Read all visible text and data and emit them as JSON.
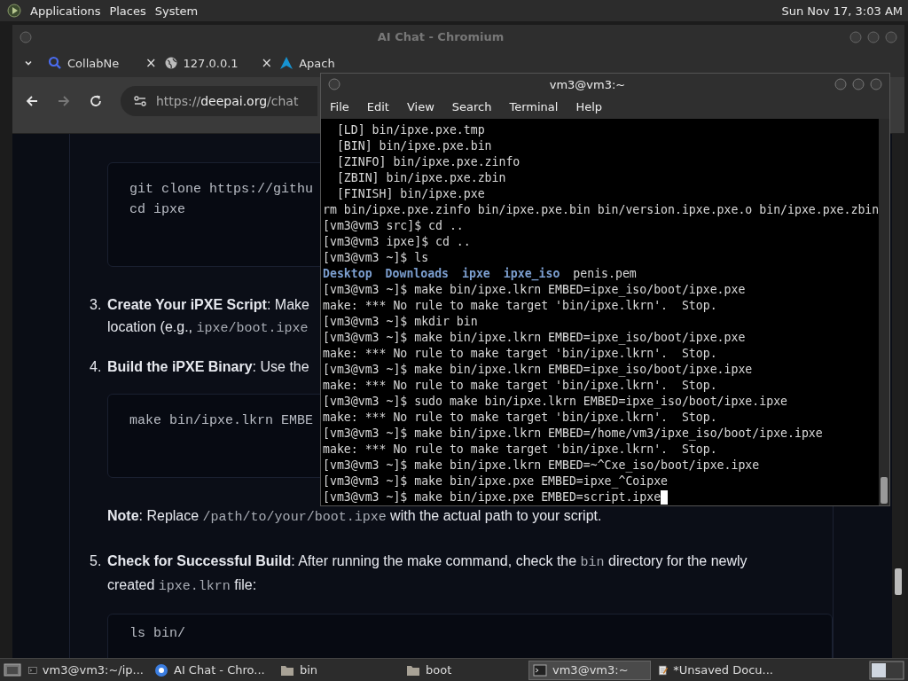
{
  "top_panel": {
    "menus": [
      "Applications",
      "Places",
      "System"
    ],
    "clock": "Sun Nov 17, 3:03 AM"
  },
  "browser": {
    "title": "AI Chat - Chromium",
    "tabs": [
      {
        "label": "CollabNe",
        "kind": "search",
        "close": "×",
        "selected": false
      },
      {
        "label": "127.0.0.1",
        "kind": "globe",
        "close": "×",
        "selected": false
      },
      {
        "label": "Apach",
        "kind": "peak",
        "selected": false
      }
    ],
    "address": {
      "scheme": "https://",
      "host": "deepai.org",
      "path": "/chat"
    },
    "forward_disabled": true,
    "content": [
      {
        "kind": "code",
        "lines": [
          "git clone https://githu",
          "cd ipxe"
        ]
      },
      {
        "kind": "step",
        "number": "3.",
        "lines": [
          [
            {
              "kind": "bold",
              "text": "Create Your iPXE Script"
            },
            {
              "kind": "text",
              "text": ": Make"
            }
          ],
          [
            {
              "kind": "text",
              "text": "location (e.g., "
            },
            {
              "kind": "code",
              "text": "ipxe/boot.ipxe"
            }
          ]
        ]
      },
      {
        "kind": "step",
        "number": "4.",
        "lines": [
          [
            {
              "kind": "bold",
              "text": "Build the iPXE Binary"
            },
            {
              "kind": "text",
              "text": ": Use the"
            }
          ]
        ]
      },
      {
        "kind": "code",
        "lines": [
          "make bin/ipxe.lkrn EMBE"
        ]
      },
      {
        "kind": "note",
        "lines": [
          [
            {
              "kind": "bold",
              "text": "Note"
            },
            {
              "kind": "text",
              "text": ": Replace "
            },
            {
              "kind": "code",
              "text": "/path/to/your/boot.ipxe"
            },
            {
              "kind": "text",
              "text": " with the actual path to your script."
            }
          ]
        ]
      },
      {
        "kind": "step",
        "number": "5.",
        "lines": [
          [
            {
              "kind": "bold",
              "text": "Check for Successful Build"
            },
            {
              "kind": "text",
              "text": ": After running the make command, check the "
            },
            {
              "kind": "code",
              "text": "bin"
            },
            {
              "kind": "text",
              "text": " directory for the newly"
            }
          ],
          [
            {
              "kind": "text",
              "text": "created "
            },
            {
              "kind": "code",
              "text": "ipxe.lkrn"
            },
            {
              "kind": "text",
              "text": " file:"
            }
          ]
        ]
      },
      {
        "kind": "code",
        "lines": [
          "ls bin/"
        ]
      }
    ]
  },
  "terminal": {
    "title": "vm3@vm3:~",
    "menus": [
      "File",
      "Edit",
      "View",
      "Search",
      "Terminal",
      "Help"
    ],
    "lines": [
      {
        "kind": "text",
        "text": "  [LD] bin/ipxe.pxe.tmp"
      },
      {
        "kind": "text",
        "text": "  [BIN] bin/ipxe.pxe.bin"
      },
      {
        "kind": "text",
        "text": "  [ZINFO] bin/ipxe.pxe.zinfo"
      },
      {
        "kind": "text",
        "text": "  [ZBIN] bin/ipxe.pxe.zbin"
      },
      {
        "kind": "text",
        "text": "  [FINISH] bin/ipxe.pxe"
      },
      {
        "kind": "text",
        "text": "rm bin/ipxe.pxe.zinfo bin/ipxe.pxe.bin bin/version.ipxe.pxe.o bin/ipxe.pxe.zbin"
      },
      {
        "kind": "text",
        "text": "[vm3@vm3 src]$ cd .."
      },
      {
        "kind": "text",
        "text": "[vm3@vm3 ipxe]$ cd .."
      },
      {
        "kind": "text",
        "text": "[vm3@vm3 ~]$ ls"
      },
      {
        "kind": "listing",
        "entries": [
          {
            "name": "Desktop",
            "kind": "dir"
          },
          {
            "name": "Downloads",
            "kind": "dir"
          },
          {
            "name": "ipxe",
            "kind": "dir"
          },
          {
            "name": "ipxe_iso",
            "kind": "dir"
          },
          {
            "name": "penis.pem",
            "kind": "file"
          }
        ]
      },
      {
        "kind": "text",
        "text": "[vm3@vm3 ~]$ make bin/ipxe.lkrn EMBED=ipxe_iso/boot/ipxe.pxe"
      },
      {
        "kind": "text",
        "text": "make: *** No rule to make target 'bin/ipxe.lkrn'.  Stop."
      },
      {
        "kind": "text",
        "text": "[vm3@vm3 ~]$ mkdir bin"
      },
      {
        "kind": "text",
        "text": "[vm3@vm3 ~]$ make bin/ipxe.lkrn EMBED=ipxe_iso/boot/ipxe.pxe"
      },
      {
        "kind": "text",
        "text": "make: *** No rule to make target 'bin/ipxe.lkrn'.  Stop."
      },
      {
        "kind": "text",
        "text": "[vm3@vm3 ~]$ make bin/ipxe.lkrn EMBED=ipxe_iso/boot/ipxe.ipxe"
      },
      {
        "kind": "text",
        "text": "make: *** No rule to make target 'bin/ipxe.lkrn'.  Stop."
      },
      {
        "kind": "text",
        "text": "[vm3@vm3 ~]$ sudo make bin/ipxe.lkrn EMBED=ipxe_iso/boot/ipxe.ipxe"
      },
      {
        "kind": "text",
        "text": "make: *** No rule to make target 'bin/ipxe.lkrn'.  Stop."
      },
      {
        "kind": "text",
        "text": "[vm3@vm3 ~]$ make bin/ipxe.lkrn EMBED=/home/vm3/ipxe_iso/boot/ipxe.ipxe"
      },
      {
        "kind": "text",
        "text": "make: *** No rule to make target 'bin/ipxe.lkrn'.  Stop."
      },
      {
        "kind": "text",
        "text": "[vm3@vm3 ~]$ make bin/ipxe.lkrn EMBED=~^Cxe_iso/boot/ipxe.ipxe"
      },
      {
        "kind": "text",
        "text": "[vm3@vm3 ~]$ make bin/ipxe.pxe EMBED=ipxe_^Coipxe"
      },
      {
        "kind": "text",
        "text": "[vm3@vm3 ~]$ make bin/ipxe.pxe EMBED=script.ipxe",
        "cursor": true
      }
    ]
  },
  "taskbar": [
    {
      "label": "vm3@vm3:~/ip...",
      "kind": "terminal",
      "selected": false
    },
    {
      "label": "AI Chat - Chro...",
      "kind": "browser",
      "selected": false
    },
    {
      "label": "bin",
      "kind": "folder",
      "selected": false
    },
    {
      "label": "boot",
      "kind": "folder",
      "selected": false
    },
    {
      "label": "vm3@vm3:~",
      "kind": "terminal",
      "selected": true
    },
    {
      "label": "*Unsaved Docu...",
      "kind": "editor",
      "selected": false
    }
  ]
}
